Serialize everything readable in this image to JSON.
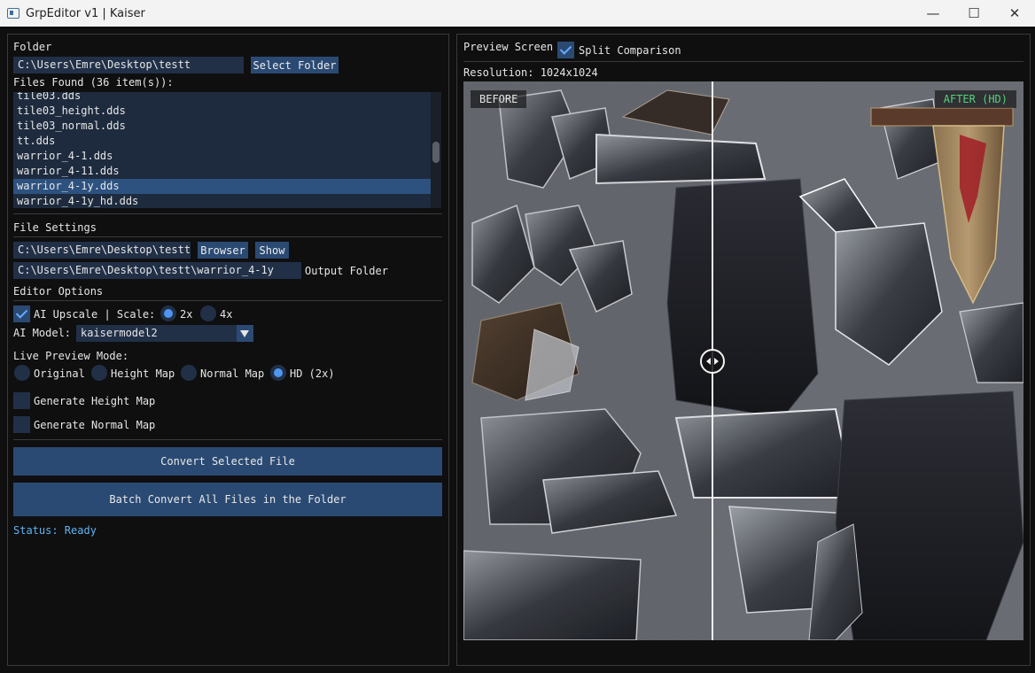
{
  "window": {
    "title": "GrpEditor v1 | Kaiser",
    "minimize": "—",
    "maximize": "☐",
    "close": "✕"
  },
  "folder": {
    "section_title": "Folder",
    "path": "C:\\Users\\Emre\\Desktop\\testt",
    "select_button": "Select Folder",
    "files_found": "Files Found (36 item(s)):"
  },
  "files": [
    "tile03.dds",
    "tile03_height.dds",
    "tile03_normal.dds",
    "tt.dds",
    "warrior_4-1.dds",
    "warrior_4-11.dds",
    "warrior_4-1y.dds",
    "warrior_4-1y_hd.dds"
  ],
  "selected_file": "warrior_4-1y.dds",
  "file_settings": {
    "section_title": "File Settings",
    "input_path": "C:\\Users\\Emre\\Desktop\\testt\\",
    "browse_button": "Browser",
    "show_button": "Show",
    "output_path": "C:\\Users\\Emre\\Desktop\\testt\\warrior_4-1y",
    "output_label": "Output Folder"
  },
  "editor_options": {
    "section_title": "Editor Options",
    "ai_upscale_label": "AI Upscale | Scale:",
    "ai_upscale_checked": true,
    "scale_2x": "2x",
    "scale_4x": "4x",
    "scale_selected": "2x",
    "ai_model_label": "AI Model:",
    "ai_model_value": "kaisermodel2",
    "live_preview_label": "Live Preview Mode:",
    "modes": [
      "Original",
      "Height Map",
      "Normal Map",
      "HD (2x)"
    ],
    "mode_selected": "HD (2x)",
    "gen_height_label": "Generate Height Map",
    "gen_height_checked": false,
    "gen_normal_label": "Generate Normal Map",
    "gen_normal_checked": false
  },
  "actions": {
    "convert_selected": "Convert Selected File",
    "batch_convert": "Batch Convert All Files in the Folder",
    "status": "Status: Ready"
  },
  "preview": {
    "title": "Preview Screen",
    "split_label": "Split Comparison",
    "split_checked": true,
    "resolution": "Resolution: 1024x1024",
    "before_tag": "BEFORE",
    "after_tag": "AFTER (HD)",
    "split_fraction": 0.445
  },
  "colors": {
    "accent": "#2a4a73",
    "selection": "#2d5280",
    "status_text": "#5fb4f0",
    "after_tag_text": "#55d27a"
  }
}
